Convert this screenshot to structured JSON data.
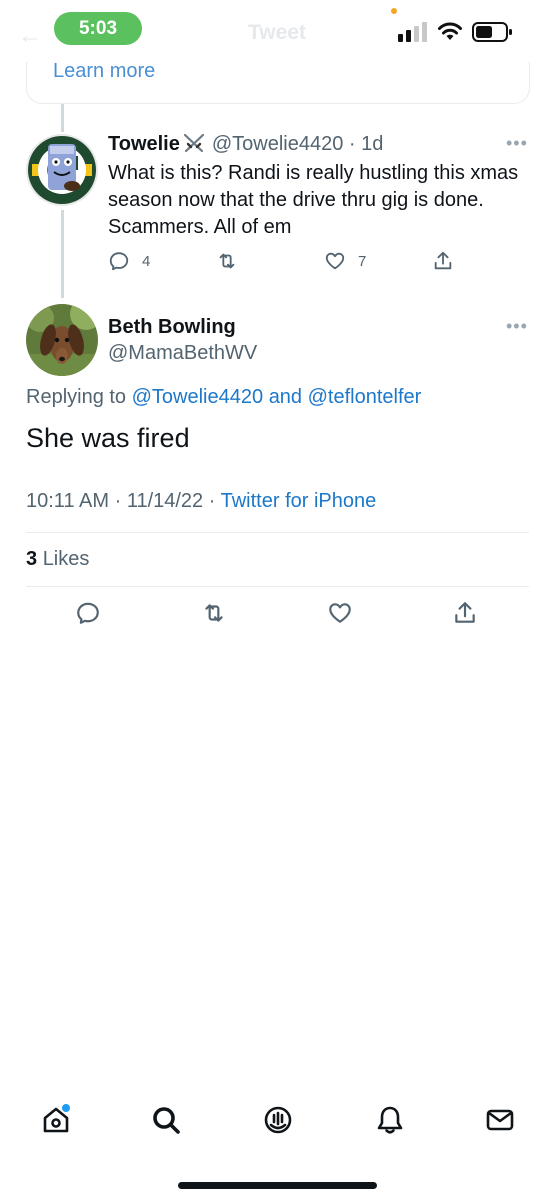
{
  "status_bar": {
    "time": "5:03"
  },
  "header": {
    "title": "Tweet",
    "back_icon": "back-arrow-icon"
  },
  "quoted_card": {
    "link_label": "Learn more"
  },
  "parent_tweet": {
    "display_name": "Towelie",
    "handle": "@Towelie4420",
    "age": "1d",
    "text": "What is this? Randi is really hustling this xmas season now that the drive thru gig is done. Scammers.  All of em",
    "replies": "4",
    "likes": "7"
  },
  "main_tweet": {
    "display_name": "Beth Bowling",
    "handle": "@MamaBethWV",
    "replying_prefix": "Replying to",
    "reply_to_1": "@Towelie4420",
    "reply_and": "and",
    "reply_to_2": "@teflontelfer",
    "text": "She was fired",
    "time": "10:11 AM",
    "date": "11/14/22",
    "source": "Twitter for iPhone",
    "likes_count": "3",
    "likes_label": "Likes"
  },
  "colors": {
    "accent": "#1d9bf0",
    "link": "#1d78c9",
    "time_pill": "#5bc15f",
    "muted_text": "#536471"
  },
  "tab_bar": {
    "items": [
      "home-icon",
      "search-icon",
      "spaces-icon",
      "notifications-icon",
      "messages-icon"
    ]
  }
}
